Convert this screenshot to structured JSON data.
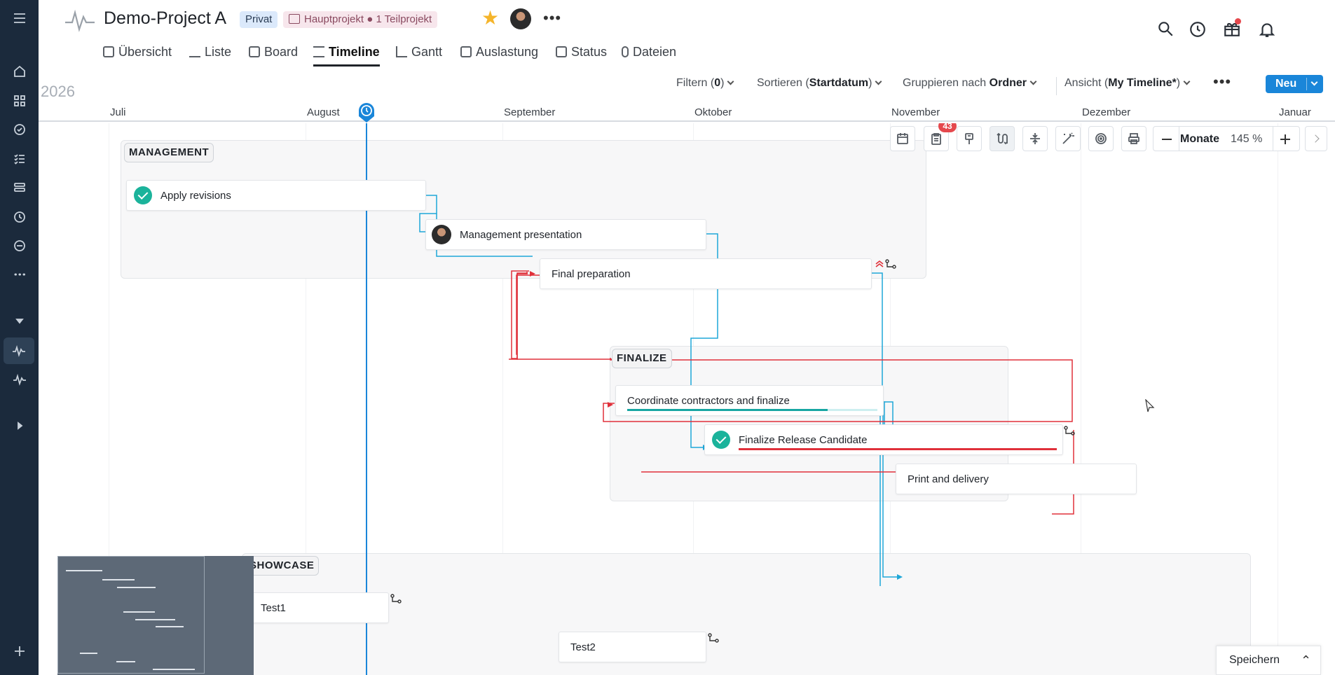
{
  "app": {
    "project_title": "Demo-Project A",
    "privacy_badge": "Privat",
    "hierarchy_badge": "Hauptprojekt ● 1 Teilprojekt"
  },
  "tabs": [
    {
      "label": "Übersicht"
    },
    {
      "label": "Liste"
    },
    {
      "label": "Board"
    },
    {
      "label": "Timeline"
    },
    {
      "label": "Gantt"
    },
    {
      "label": "Auslastung"
    },
    {
      "label": "Status"
    },
    {
      "label": "Dateien"
    }
  ],
  "toolbar": {
    "year": "2026",
    "filter_prefix": "Filtern (",
    "filter_count": "0",
    "filter_suffix": ")",
    "sort_prefix": "Sortieren (",
    "sort_value": "Startdatum",
    "sort_suffix": ")",
    "group_prefix": "Gruppieren nach ",
    "group_value": "Ordner",
    "view_prefix": "Ansicht (",
    "view_value": "My Timeline*",
    "view_suffix": ")",
    "new_button": "Neu"
  },
  "months": [
    "Juli",
    "August",
    "September",
    "Oktober",
    "November",
    "Dezember",
    "Januar"
  ],
  "timeline_tools": {
    "badge_count": "43",
    "zoom_unit": "Monate",
    "zoom_percent": "145 %"
  },
  "groups": [
    {
      "label": "MANAGEMENT"
    },
    {
      "label": "FINALIZE"
    },
    {
      "label": "SHOWCASE"
    }
  ],
  "tasks": {
    "apply_revisions": "Apply revisions",
    "management_presentation": "Management presentation",
    "final_preparation": "Final preparation",
    "coordinate_contractors": "Coordinate contractors and finalize",
    "finalize_release": "Finalize Release Candidate",
    "print_delivery": "Print and delivery",
    "test1": "Test1",
    "test2": "Test2"
  },
  "progress": {
    "coordinate_contractors": 0.8
  },
  "footer": {
    "save_label": "Speichern"
  },
  "colors": {
    "sidebar": "#1b2a3c",
    "accent": "#1a86d9",
    "dependency_blue": "#1ea7d8",
    "dependency_red": "#e0303a",
    "complete": "#1bb39b"
  }
}
